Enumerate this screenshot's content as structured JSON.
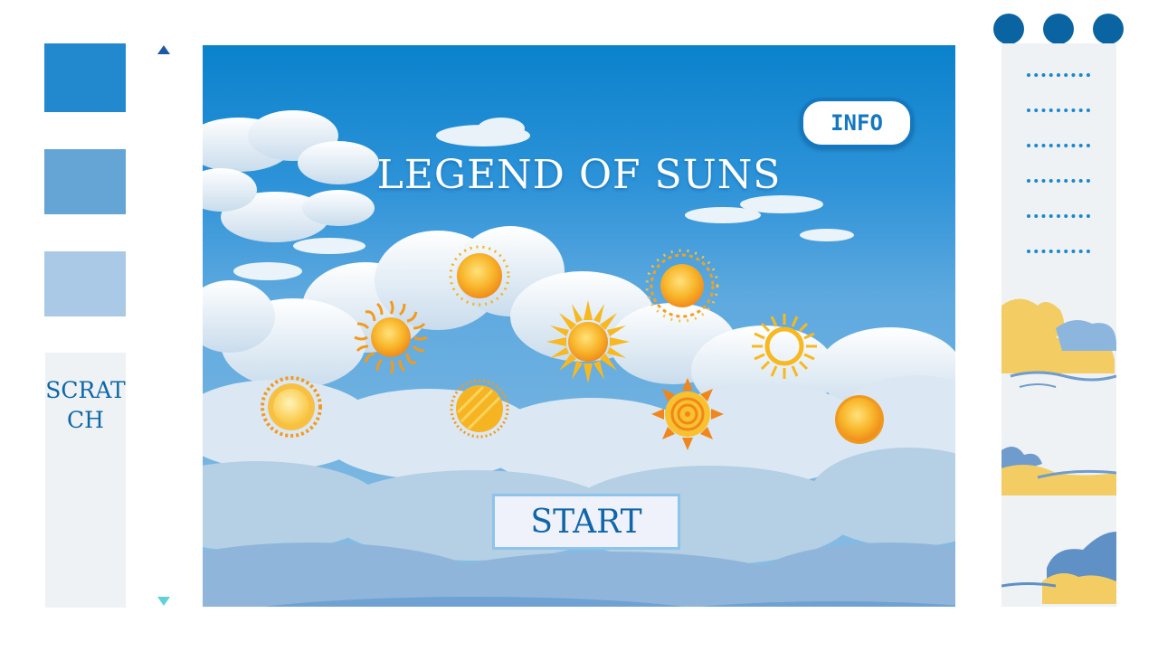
{
  "game": {
    "title": "LEGEND OF SUNS",
    "info_label": "INFO",
    "start_label": "START"
  },
  "sidebar": {
    "scratch_label": "SCRATCH",
    "swatches": [
      "#2389cf",
      "#64a5d6",
      "#a9c9e6"
    ]
  },
  "window_controls": [
    "circle-icon",
    "circle-icon",
    "circle-icon"
  ],
  "menu": {
    "items": [
      "..........",
      "..........",
      "..........",
      "..........",
      "..........",
      ".........."
    ]
  },
  "suns": [
    {
      "name": "sun-dotted-icon"
    },
    {
      "name": "sun-wavy-rays-icon"
    },
    {
      "name": "sun-spiky-icon"
    },
    {
      "name": "sun-ornate-icon"
    },
    {
      "name": "sun-ring-icon"
    },
    {
      "name": "sun-haloed-icon"
    },
    {
      "name": "sun-striped-icon"
    },
    {
      "name": "sun-spiral-icon"
    },
    {
      "name": "sun-plain-icon"
    }
  ],
  "colors": {
    "accent": "#0b64a2",
    "sky_top": "#0a82cc",
    "sun_gold": "#f7b21c",
    "sun_orange": "#f08a1a"
  }
}
